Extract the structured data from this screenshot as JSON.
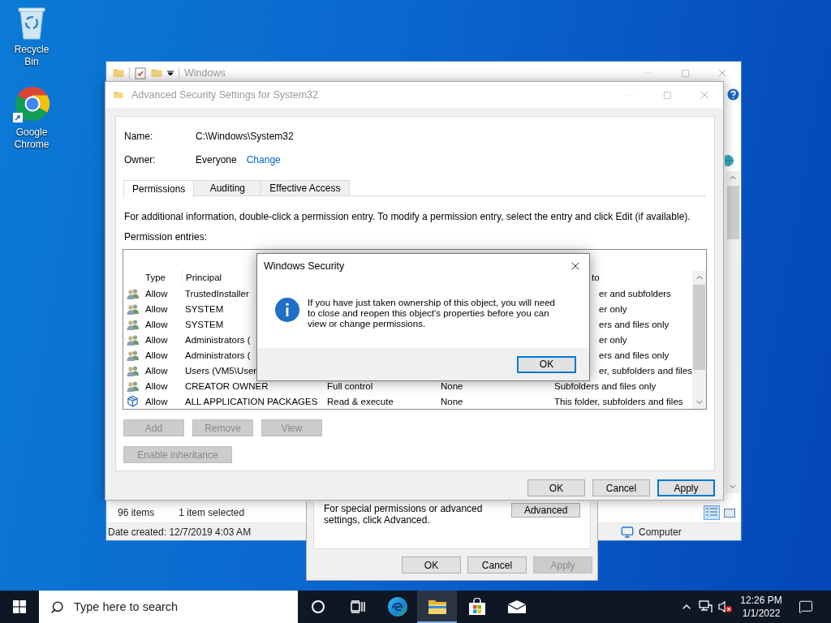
{
  "desktop_icons": [
    {
      "kind": "recycle_bin",
      "label": "Recycle Bin"
    },
    {
      "kind": "chrome",
      "label": "Google Chrome"
    }
  ],
  "explorer": {
    "title": "Windows",
    "status": {
      "items": "96 items",
      "selection": "1 item selected",
      "date_created": "Date created: 12/7/2019 4:03 AM",
      "location": "Computer"
    }
  },
  "properties_dialog": {
    "note": "For special permissions or advanced settings, click Advanced.",
    "advanced_button": "Advanced",
    "buttons": [
      {
        "label": "OK",
        "disabled": false
      },
      {
        "label": "Cancel",
        "disabled": false
      },
      {
        "label": "Apply",
        "disabled": true
      }
    ]
  },
  "advanced_security": {
    "title": "Advanced Security Settings for System32",
    "name_label": "Name:",
    "name": "C:\\Windows\\System32",
    "owner_label": "Owner:",
    "owner": "Everyone",
    "change_link": "Change",
    "tabs": [
      {
        "label": "Permissions",
        "selected": true
      },
      {
        "label": "Auditing",
        "selected": false
      },
      {
        "label": "Effective Access",
        "selected": false
      }
    ],
    "info": "For additional information, double-click a permission entry. To modify a permission entry, select the entry and click Edit (if available).",
    "entries_label": "Permission entries:",
    "table": {
      "columns": [
        {
          "label": "Type"
        },
        {
          "label": "Principal"
        },
        {
          "label": "to"
        }
      ],
      "rows": [
        {
          "kind": "users",
          "type": "Allow",
          "principal": "TrustedInstaller",
          "applies_to": "er and subfolders",
          "covered": true
        },
        {
          "kind": "users",
          "type": "Allow",
          "principal": "SYSTEM",
          "applies_to": "er only",
          "covered": true
        },
        {
          "kind": "users",
          "type": "Allow",
          "principal": "SYSTEM",
          "applies_to": "ers and files only",
          "covered": true
        },
        {
          "kind": "users",
          "type": "Allow",
          "principal": "Administrators (",
          "applies_to": "er only",
          "covered": true
        },
        {
          "kind": "users",
          "type": "Allow",
          "principal": "Administrators (",
          "applies_to": "ers and files only",
          "covered": true
        },
        {
          "kind": "users",
          "type": "Allow",
          "principal": "Users (VM5\\User",
          "applies_to": "er, subfolders and files",
          "covered": true
        },
        {
          "kind": "users",
          "type": "Allow",
          "principal": "CREATOR OWNER",
          "access": "Full control",
          "inherited": "None",
          "applies_to": "Subfolders and files only",
          "covered": false
        },
        {
          "kind": "packages",
          "type": "Allow",
          "principal": "ALL APPLICATION PACKAGES",
          "access": "Read & execute",
          "inherited": "None",
          "applies_to": "This folder, subfolders and files",
          "covered": false
        }
      ]
    },
    "actions": [
      {
        "label": "Add",
        "disabled": true
      },
      {
        "label": "Remove",
        "disabled": true
      },
      {
        "label": "View",
        "disabled": true
      }
    ],
    "inheritance_button": {
      "label": "Enable inheritance",
      "disabled": true
    },
    "buttons": [
      {
        "label": "OK",
        "default": false
      },
      {
        "label": "Cancel",
        "default": false
      },
      {
        "label": "Apply",
        "default": true
      }
    ]
  },
  "message_box": {
    "title": "Windows Security",
    "message": "If you have just taken ownership of this object, you will need to close and reopen this object's properties before you can view or change permissions.",
    "button": "OK"
  },
  "taskbar": {
    "search_placeholder": "Type here to search",
    "apps": [
      {
        "kind": "cortana",
        "running": false
      },
      {
        "kind": "task_view",
        "running": false
      },
      {
        "kind": "edge",
        "running": false
      },
      {
        "kind": "explorer",
        "running": true
      },
      {
        "kind": "store",
        "running": false
      },
      {
        "kind": "mail",
        "running": false
      }
    ],
    "time": "12:26 PM",
    "date": "1/1/2022"
  }
}
